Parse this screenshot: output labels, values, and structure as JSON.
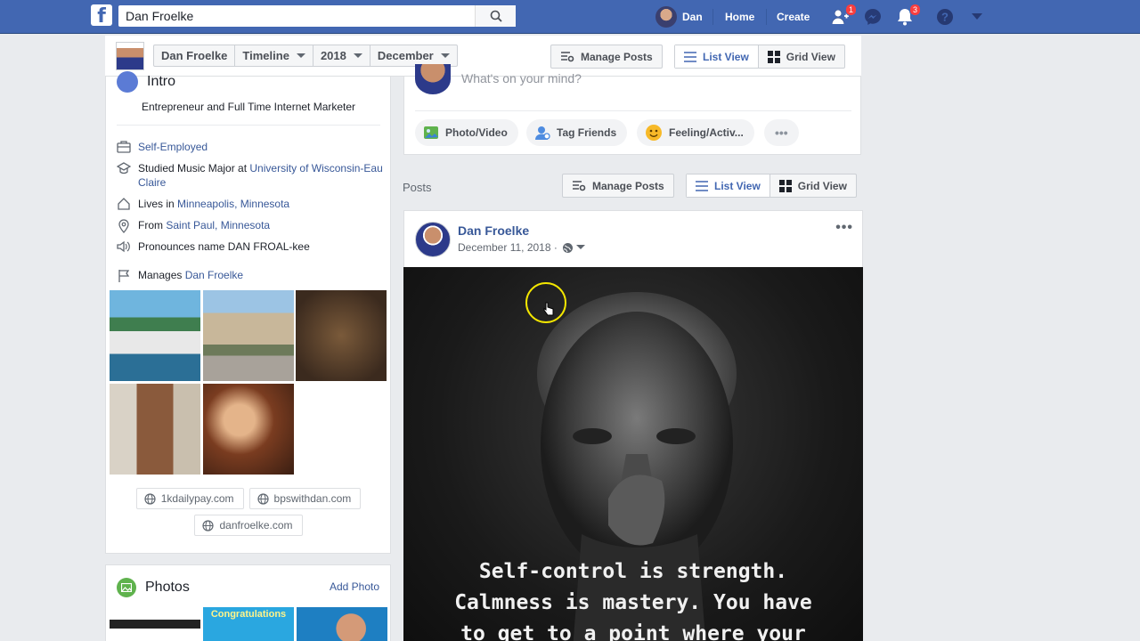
{
  "topbar": {
    "search_value": "Dan Froelke",
    "user_name": "Dan",
    "home_label": "Home",
    "create_label": "Create",
    "friend_requests_badge": "1",
    "notifications_badge": "3",
    "brand_color": "#4267b2"
  },
  "timeline_bar": {
    "crumbs": [
      "Dan Froelke",
      "Timeline",
      "2018",
      "December"
    ],
    "manage_posts": "Manage Posts",
    "list_view": "List View",
    "grid_view": "Grid View"
  },
  "intro": {
    "title": "Intro",
    "bio": "Entrepreneur and Full Time Internet Marketer",
    "work": "Self-Employed",
    "education_prefix": "Studied Music Major at ",
    "education_link": "University of Wisconsin-Eau Claire",
    "lives_prefix": "Lives in ",
    "lives_link": "Minneapolis, Minnesota",
    "from_prefix": "From ",
    "from_link": "Saint Paul, Minnesota",
    "pronounce": "Pronounces name DAN FROAL-kee",
    "manages_prefix": "Manages ",
    "manages_link": "Dan Froelke",
    "websites": [
      "1kdailypay.com",
      "bpswithdan.com",
      "danfroelke.com"
    ]
  },
  "photos_card": {
    "title": "Photos",
    "add_photo": "Add Photo",
    "thumb_caption": "Congratulations"
  },
  "composer": {
    "placeholder": "What's on your mind?",
    "photo_video": "Photo/Video",
    "tag_friends": "Tag Friends",
    "feeling": "Feeling/Activ...",
    "more": "•••"
  },
  "posts_section": {
    "label": "Posts",
    "manage_posts": "Manage Posts",
    "list_view": "List View",
    "grid_view": "Grid View"
  },
  "post": {
    "author": "Dan Froelke",
    "date": "December 11, 2018 ·",
    "more": "•••",
    "quote_lines": [
      "Self-control is strength.",
      "Calmness is mastery. You have",
      "to get to a point where your"
    ]
  }
}
